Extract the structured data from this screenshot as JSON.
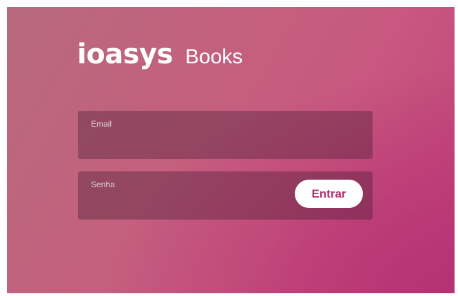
{
  "logo": {
    "brand": "ioasys",
    "product": "Books"
  },
  "form": {
    "email": {
      "label": "Email",
      "value": ""
    },
    "password": {
      "label": "Senha",
      "value": ""
    },
    "submit_label": "Entrar"
  },
  "colors": {
    "background_start": "#b86a7c",
    "background_end": "#bf3f79",
    "button_text": "#b22e6f",
    "button_bg": "#ffffff"
  }
}
